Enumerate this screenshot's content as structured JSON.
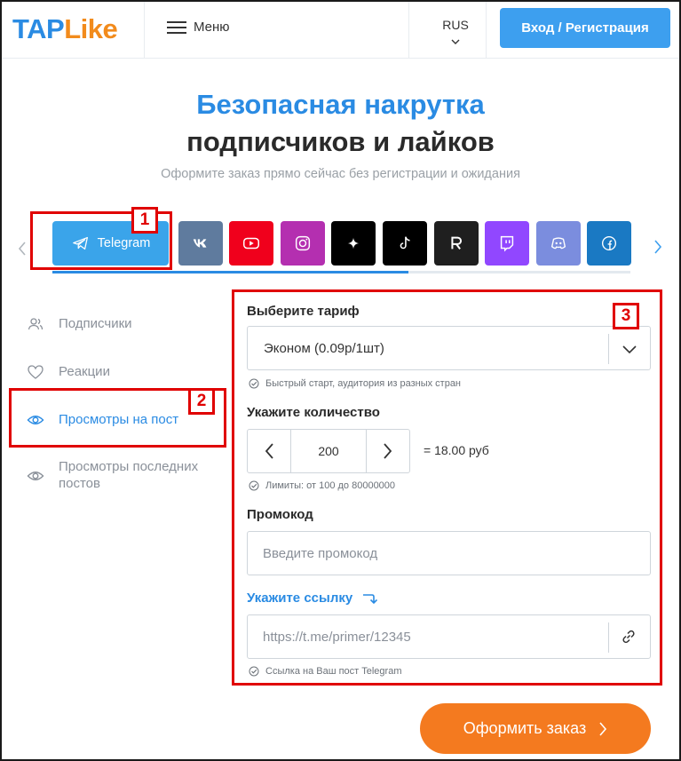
{
  "header": {
    "logo_part1": "TAP",
    "logo_part2": "Like",
    "menu_label": "Меню",
    "lang": "RUS",
    "login_label": "Вход / Регистрация"
  },
  "hero": {
    "title_line1": "Безопасная накрутка",
    "title_line2": "подписчиков и лайков",
    "subtitle": "Оформите заказ прямо сейчас без регистрации и ожидания"
  },
  "platforms": [
    {
      "name": "Telegram",
      "color": "#3aa4ea",
      "icon": "telegram-icon"
    },
    {
      "name": "VK",
      "color": "#5f7b9e",
      "icon": "vk-icon"
    },
    {
      "name": "YouTube",
      "color": "#f0001c",
      "icon": "youtube-icon"
    },
    {
      "name": "Instagram",
      "color": "#b42fb0",
      "icon": "instagram-icon"
    },
    {
      "name": "Likee",
      "color": "#000000",
      "icon": "likee-icon"
    },
    {
      "name": "TikTok",
      "color": "#000000",
      "icon": "tiktok-icon"
    },
    {
      "name": "Rutube",
      "color": "#1f1f1f",
      "icon": "rutube-icon"
    },
    {
      "name": "Twitch",
      "color": "#9147ff",
      "icon": "twitch-icon"
    },
    {
      "name": "Discord",
      "color": "#7b8dde",
      "icon": "discord-icon"
    },
    {
      "name": "Facebook",
      "color": "#1a79c3",
      "icon": "facebook-icon"
    }
  ],
  "sidebar": {
    "items": [
      {
        "label": "Подписчики",
        "icon": "users-icon"
      },
      {
        "label": "Реакции",
        "icon": "heart-icon"
      },
      {
        "label": "Просмотры на пост",
        "icon": "eye-icon",
        "active": true
      },
      {
        "label": "Просмотры последних постов",
        "icon": "eye-icon"
      }
    ]
  },
  "form": {
    "tariff_label": "Выберите тариф",
    "tariff_value": "Эконом (0.09р/1шт)",
    "tariff_hint": "Быстрый старт, аудитория из разных стран",
    "quantity_label": "Укажите количество",
    "quantity_value": "200",
    "price": "= 18.00 руб",
    "quantity_hint": "Лимиты: от 100 до 80000000",
    "promo_label": "Промокод",
    "promo_placeholder": "Введите промокод",
    "link_label": "Укажите ссылку",
    "link_placeholder": "https://t.me/primer/12345",
    "link_hint": "Ссылка на Ваш пост Telegram",
    "submit_label": "Оформить заказ"
  },
  "annotations": {
    "badge1": "1",
    "badge2": "2",
    "badge3": "3"
  },
  "colors": {
    "accent": "#2a8be3",
    "button_blue": "#3d9fef",
    "order_orange": "#f47a1f",
    "annotation_red": "#e00000"
  }
}
